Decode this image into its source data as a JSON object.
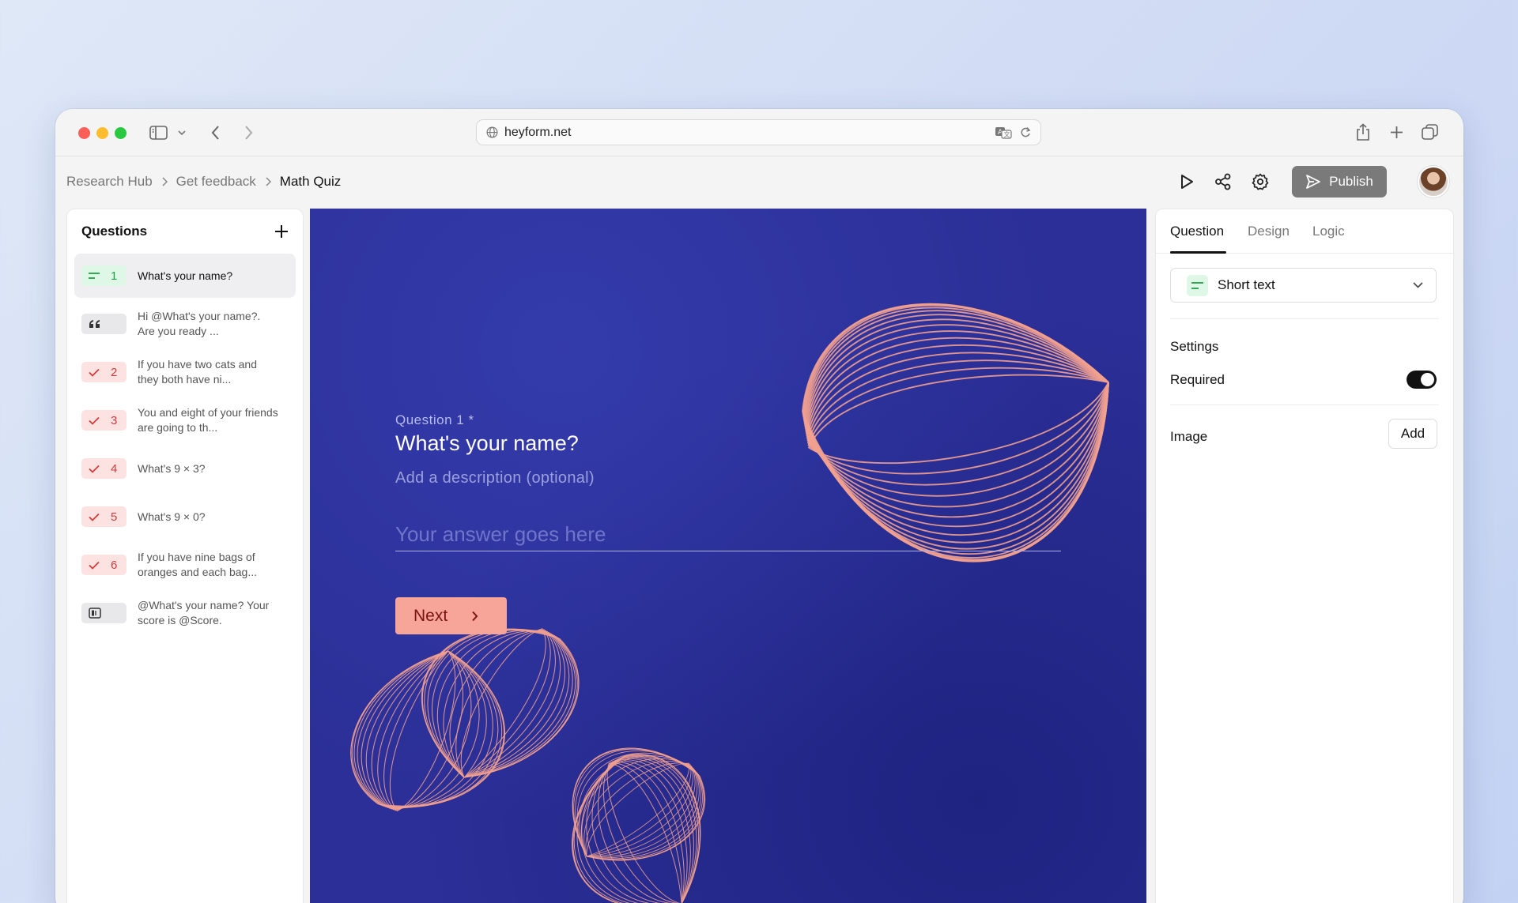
{
  "browser": {
    "url": "heyform.net"
  },
  "breadcrumb": {
    "items": [
      "Research Hub",
      "Get feedback",
      "Math Quiz"
    ]
  },
  "toolbar": {
    "publish_label": "Publish"
  },
  "questions_panel": {
    "title": "Questions",
    "items": [
      {
        "badge": "short-text",
        "number": "1",
        "text": "What's your name?",
        "color": "green",
        "active": true
      },
      {
        "badge": "quote",
        "number": "",
        "text": "Hi @What's your name?. Are you ready ...",
        "color": "gray",
        "active": false
      },
      {
        "badge": "check",
        "number": "2",
        "text": "If you have two cats and they both have ni...",
        "color": "red",
        "active": false
      },
      {
        "badge": "check",
        "number": "3",
        "text": "You and eight of your friends are going to th...",
        "color": "red",
        "active": false
      },
      {
        "badge": "check",
        "number": "4",
        "text": "What's 9 × 3?",
        "color": "red",
        "active": false
      },
      {
        "badge": "check",
        "number": "5",
        "text": "What's 9 × 0?",
        "color": "red",
        "active": false
      },
      {
        "badge": "check",
        "number": "6",
        "text": "If you have nine bags of oranges and each bag...",
        "color": "red",
        "active": false
      },
      {
        "badge": "statement",
        "number": "",
        "text": "@What's your name? Your score is @Score.",
        "color": "gray",
        "active": false
      }
    ]
  },
  "canvas": {
    "question_label": "Question 1 *",
    "question_title": "What's your name?",
    "description_placeholder": "Add a description (optional)",
    "answer_placeholder": "Your answer goes here",
    "next_label": "Next",
    "colors": {
      "background": "#2b2f97",
      "accent": "#f7a598",
      "line": "#f2a08f"
    }
  },
  "settings_panel": {
    "tabs": [
      "Question",
      "Design",
      "Logic"
    ],
    "active_tab": "Question",
    "question_type": "Short text",
    "settings_title": "Settings",
    "required_label": "Required",
    "required": true,
    "image_label": "Image",
    "add_label": "Add"
  }
}
